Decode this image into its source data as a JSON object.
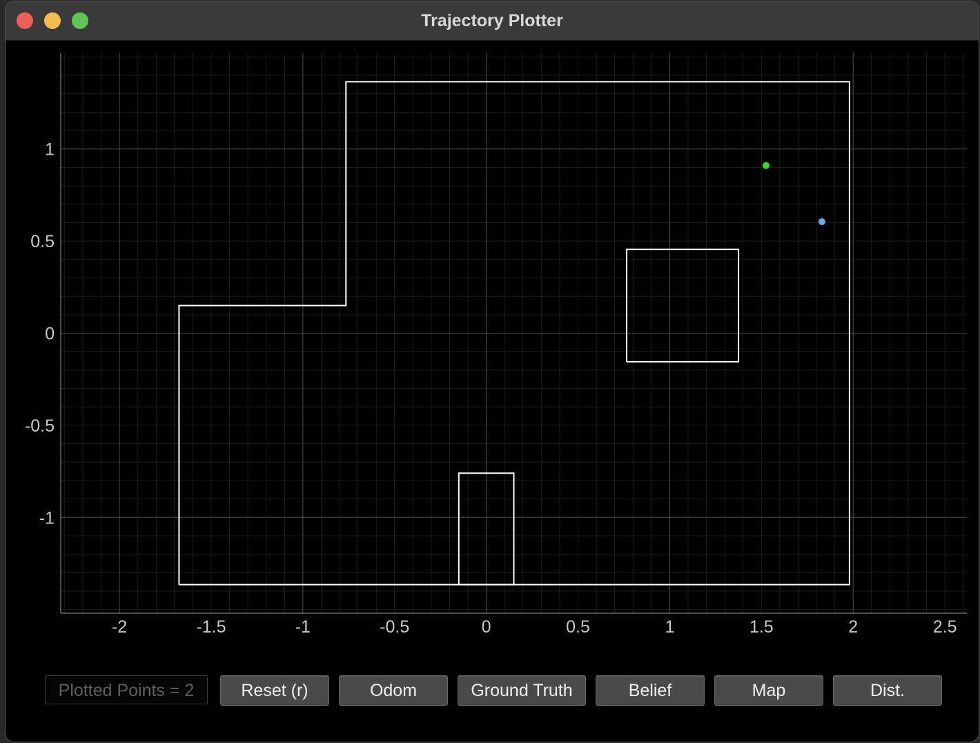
{
  "window": {
    "title": "Trajectory Plotter"
  },
  "chart_data": {
    "type": "scatter",
    "title": "",
    "xlabel": "",
    "ylabel": "",
    "xlim": [
      -2.32,
      2.62
    ],
    "ylim": [
      -1.52,
      1.52
    ],
    "x_ticks": [
      -2,
      -1.5,
      -1,
      -0.5,
      0,
      0.5,
      1,
      1.5,
      2,
      2.5
    ],
    "x_tick_labels": [
      "-2",
      "-1.5",
      "-1",
      "-0.5",
      "0",
      "0.5",
      "1",
      "1.5",
      "2",
      "2.5"
    ],
    "y_ticks": [
      1,
      0.5,
      0,
      -0.5,
      -1
    ],
    "y_tick_labels": [
      "1",
      "0.5",
      "0",
      "-0.5",
      "-1"
    ],
    "grid": true,
    "series": [
      {
        "color": "#33dd22",
        "points": [
          [
            1.525,
            0.91
          ]
        ]
      },
      {
        "color": "#6fa8e8",
        "points": [
          [
            1.83,
            0.605
          ]
        ]
      }
    ],
    "map_polygons": [
      [
        [
          -1.675,
          -1.365
        ],
        [
          1.98,
          -1.365
        ],
        [
          1.98,
          1.365
        ],
        [
          -0.765,
          1.365
        ],
        [
          -0.765,
          0.15
        ],
        [
          -1.675,
          0.15
        ],
        [
          -1.675,
          -1.365
        ]
      ],
      [
        [
          0.765,
          -0.155
        ],
        [
          1.375,
          -0.155
        ],
        [
          1.375,
          0.455
        ],
        [
          0.765,
          0.455
        ],
        [
          0.765,
          -0.155
        ]
      ],
      [
        [
          -0.15,
          -1.365
        ],
        [
          0.15,
          -1.365
        ],
        [
          0.15,
          -0.76
        ],
        [
          -0.15,
          -0.76
        ],
        [
          -0.15,
          -1.365
        ]
      ]
    ]
  },
  "controls": {
    "counter_text": "Plotted Points = 2",
    "buttons": [
      "Reset (r)",
      "Odom",
      "Ground Truth",
      "Belief",
      "Map",
      "Dist."
    ]
  },
  "colors": {
    "background": "#000000",
    "grid_major": "#4a4a4a",
    "grid_minor": "#1c1c1c",
    "map_line": "#ffffff",
    "tick_text": "#c8c8c8"
  }
}
